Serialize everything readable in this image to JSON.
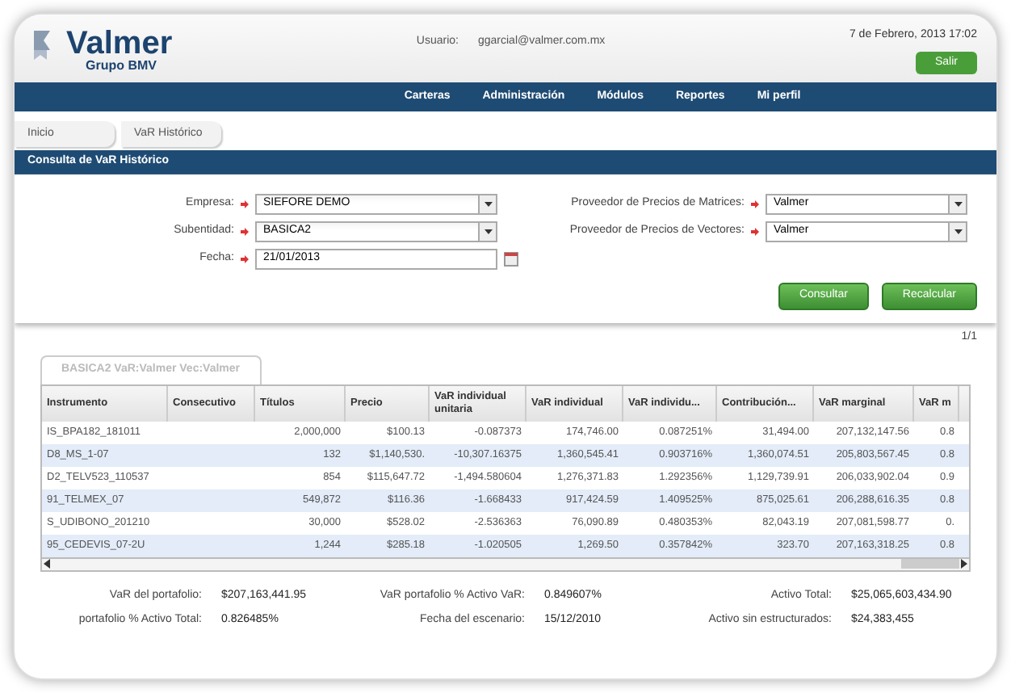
{
  "header": {
    "logo_name": "Valmer",
    "logo_sub": "Grupo BMV",
    "user_label": "Usuario:",
    "user": "ggarcial@valmer.com.mx",
    "datetime": "7 de Febrero, 2013 17:02",
    "logout": "Salir"
  },
  "nav": [
    {
      "label": "Carteras"
    },
    {
      "label": "Administración"
    },
    {
      "label": "Módulos"
    },
    {
      "label": "Reportes"
    },
    {
      "label": "Mi perfil"
    }
  ],
  "breadcrumbs": [
    {
      "label": "Inicio"
    },
    {
      "label": "VaR Histórico"
    }
  ],
  "panel_title": "Consulta de VaR Histórico",
  "left_fields": [
    {
      "label": "Empresa:",
      "value": "SIEFORE DEMO",
      "kind": "select"
    },
    {
      "label": "Subentidad:",
      "value": "BASICA2",
      "kind": "select"
    },
    {
      "label": "Fecha:",
      "value": "21/01/2013",
      "kind": "date"
    }
  ],
  "right_fields": [
    {
      "label": "Proveedor de Precios de Matrices:",
      "value": "Valmer",
      "kind": "select"
    },
    {
      "label": "Proveedor de Precios de Vectores:",
      "value": "Valmer",
      "kind": "select"
    }
  ],
  "buttons": [
    "Consultar",
    "Recalcular"
  ],
  "pager": "1/1",
  "tab": {
    "label": "BASICA2 VaR:Valmer Vec:Valmer",
    "selected": true
  },
  "table": {
    "columns": [
      "Instrumento",
      "Consecutivo",
      "Títulos",
      "Precio",
      "VaR individual unitaria",
      "VaR individual",
      "VaR individu...",
      "Contribución...",
      "VaR marginal",
      "VaR m"
    ],
    "rows": [
      [
        "IS_BPA182_181011",
        "",
        "2,000,000",
        "$100.13",
        "-0.087373",
        "174,746.00",
        "0.087251%",
        "31,494.00",
        "207,132,147.56",
        "0.8"
      ],
      [
        "D8_MS_1-07",
        "",
        "132",
        "$1,140,530.",
        "-10,307.16375",
        "1,360,545.41",
        "0.903716%",
        "1,360,074.51",
        "205,803,567.45",
        "0.8"
      ],
      [
        "D2_TELV523_110537",
        "",
        "854",
        "$115,647.72",
        "-1,494.580604",
        "1,276,371.83",
        "1.292356%",
        "1,129,739.91",
        "206,033,902.04",
        "0.9"
      ],
      [
        "91_TELMEX_07",
        "",
        "549,872",
        "$116.36",
        "-1.668433",
        "917,424.59",
        "1.409525%",
        "875,025.61",
        "206,288,616.35",
        "0.8"
      ],
      [
        "S_UDIBONO_201210",
        "",
        "30,000",
        "$528.02",
        "-2.536363",
        "76,090.89",
        "0.480353%",
        "82,043.19",
        "207,081,598.77",
        "0."
      ],
      [
        "95_CEDEVIS_07-2U",
        "",
        "1,244",
        "$285.18",
        "-1.020505",
        "1,269.50",
        "0.357842%",
        "323.70",
        "207,163,318.25",
        "0.8"
      ]
    ]
  },
  "summary": [
    [
      {
        "label": "VaR del portafolio:",
        "value": "$207,163,441.95"
      },
      {
        "label": "VaR portafolio % Activo VaR:",
        "value": "0.849607%"
      },
      {
        "label": "Activo Total:",
        "value": "$25,065,603,434.90"
      }
    ],
    [
      {
        "label": "portafolio % Activo Total:",
        "value": "0.826485%"
      },
      {
        "label": "Fecha del escenario:",
        "value": "15/12/2010"
      },
      {
        "label": "Activo sin estructurados:",
        "value": "$24,383,455"
      }
    ]
  ]
}
